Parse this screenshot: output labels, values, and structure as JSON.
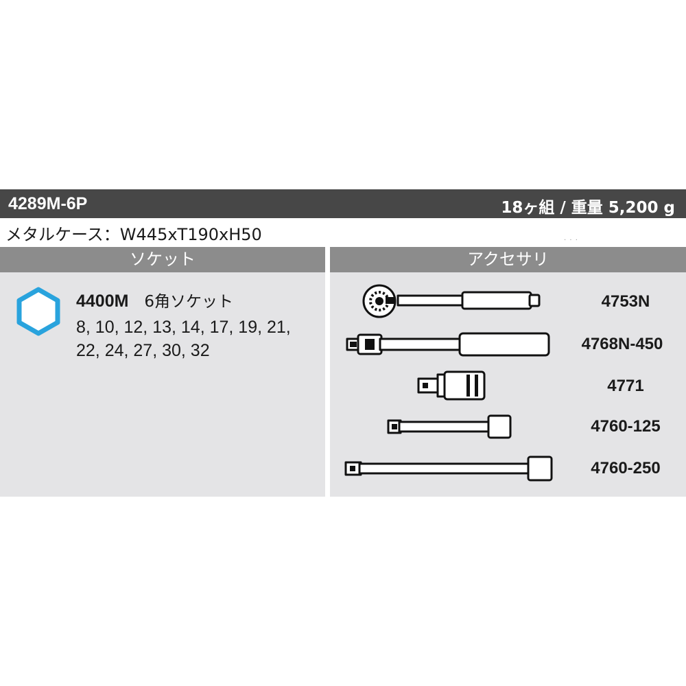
{
  "header": {
    "model": "4289M-6P",
    "spec": "18ヶ組 / 重量 5,200 g"
  },
  "case": {
    "text": "メタルケース：W445xT190xH50"
  },
  "sockets": {
    "header": "ソケット",
    "code": "4400M",
    "name": "6角ソケット",
    "sizes_line1": "8, 10, 12, 13, 14, 17, 19, 21,",
    "sizes_line2": "22, 24, 27, 30, 32",
    "icon": "hexagon-socket-icon",
    "accent_color": "#29a3dd"
  },
  "accessories": {
    "header": "アクセサリ",
    "items": [
      {
        "code": "4753N",
        "icon": "ratchet-handle-icon"
      },
      {
        "code": "4768N-450",
        "icon": "flex-handle-icon"
      },
      {
        "code": "4771",
        "icon": "adapter-icon"
      },
      {
        "code": "4760-125",
        "icon": "extension-bar-short-icon"
      },
      {
        "code": "4760-250",
        "icon": "extension-bar-long-icon"
      }
    ]
  },
  "colors": {
    "title_bar": "#474747",
    "panel_header": "#8c8c8c",
    "panel_bg": "#e4e4e6"
  }
}
